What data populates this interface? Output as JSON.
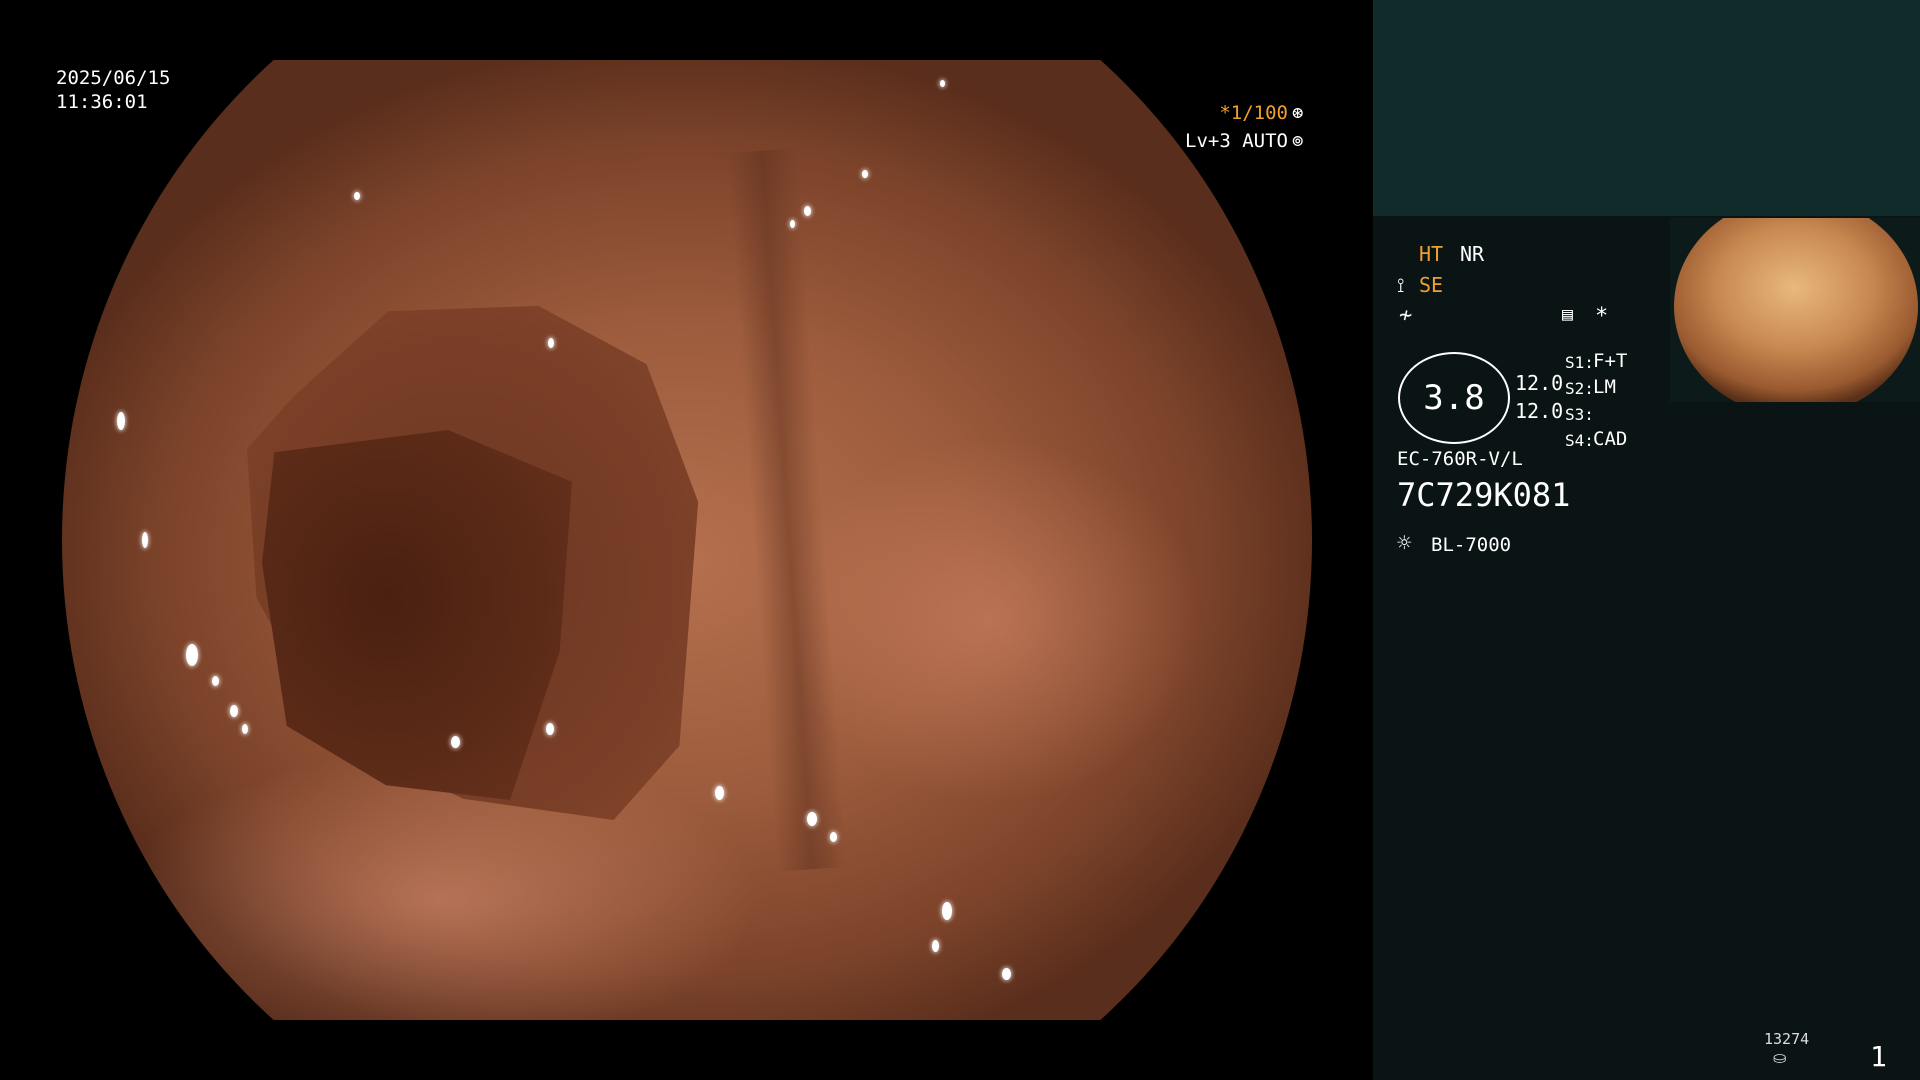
{
  "overlay": {
    "date": "2025/06/15",
    "time": "11:36:01",
    "shutter": "*1/100",
    "shutter_icon": "aperture-icon",
    "level": "Lv+3 AUTO",
    "level_icon": "iris-icon"
  },
  "status": {
    "ht": "HT",
    "nr": "NR",
    "se": "SE",
    "se_icon": "enhance-icon",
    "f_icon": "freeze-icon",
    "menu_icon": "settings-card-icon",
    "star": "*",
    "scale_value": "3.8",
    "value_a": "12.0",
    "value_b": "12.0",
    "s1_label": "S1:",
    "s1_value": "F+T",
    "s2_label": "S2:",
    "s2_value": "LM",
    "s3_label": "S3:",
    "s3_value": "",
    "s4_label": "S4:",
    "s4_value": "CAD",
    "scope_model": "EC-760R-V/L",
    "scope_serial": "7C729K081",
    "light_icon": "light-source-icon",
    "light_source": "BL-7000"
  },
  "footer": {
    "counter": "13274",
    "counter_icon": "storage-icon",
    "page": "1"
  },
  "colors": {
    "accent_orange": "#f0a030",
    "panel_bg": "#0b1414",
    "panel_top": "#0f2b2a"
  }
}
